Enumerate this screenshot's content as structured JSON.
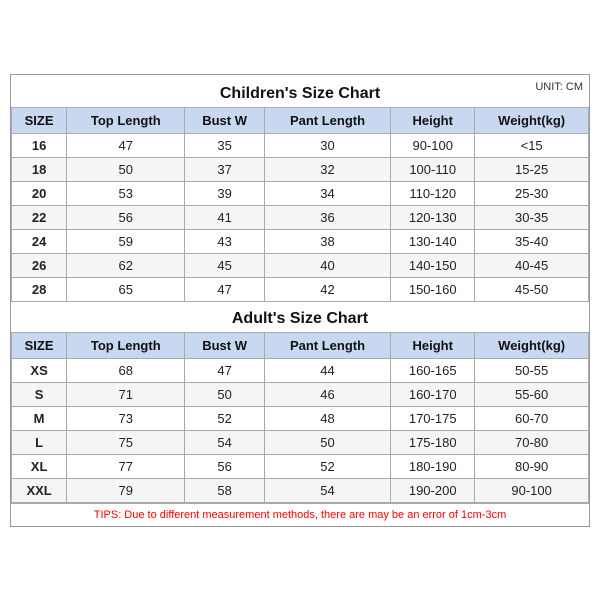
{
  "unit_label": "UNIT: CM",
  "children": {
    "title": "Children's Size Chart",
    "headers": [
      "SIZE",
      "Top Length",
      "Bust W",
      "Pant Length",
      "Height",
      "Weight(kg)"
    ],
    "rows": [
      [
        "16",
        "47",
        "35",
        "30",
        "90-100",
        "<15"
      ],
      [
        "18",
        "50",
        "37",
        "32",
        "100-110",
        "15-25"
      ],
      [
        "20",
        "53",
        "39",
        "34",
        "110-120",
        "25-30"
      ],
      [
        "22",
        "56",
        "41",
        "36",
        "120-130",
        "30-35"
      ],
      [
        "24",
        "59",
        "43",
        "38",
        "130-140",
        "35-40"
      ],
      [
        "26",
        "62",
        "45",
        "40",
        "140-150",
        "40-45"
      ],
      [
        "28",
        "65",
        "47",
        "42",
        "150-160",
        "45-50"
      ]
    ]
  },
  "adult": {
    "title": "Adult's Size Chart",
    "headers": [
      "SIZE",
      "Top Length",
      "Bust W",
      "Pant Length",
      "Height",
      "Weight(kg)"
    ],
    "rows": [
      [
        "XS",
        "68",
        "47",
        "44",
        "160-165",
        "50-55"
      ],
      [
        "S",
        "71",
        "50",
        "46",
        "160-170",
        "55-60"
      ],
      [
        "M",
        "73",
        "52",
        "48",
        "170-175",
        "60-70"
      ],
      [
        "L",
        "75",
        "54",
        "50",
        "175-180",
        "70-80"
      ],
      [
        "XL",
        "77",
        "56",
        "52",
        "180-190",
        "80-90"
      ],
      [
        "XXL",
        "79",
        "58",
        "54",
        "190-200",
        "90-100"
      ]
    ]
  },
  "tips": "TIPS: Due to different measurement methods, there are may be an error of 1cm-3cm"
}
